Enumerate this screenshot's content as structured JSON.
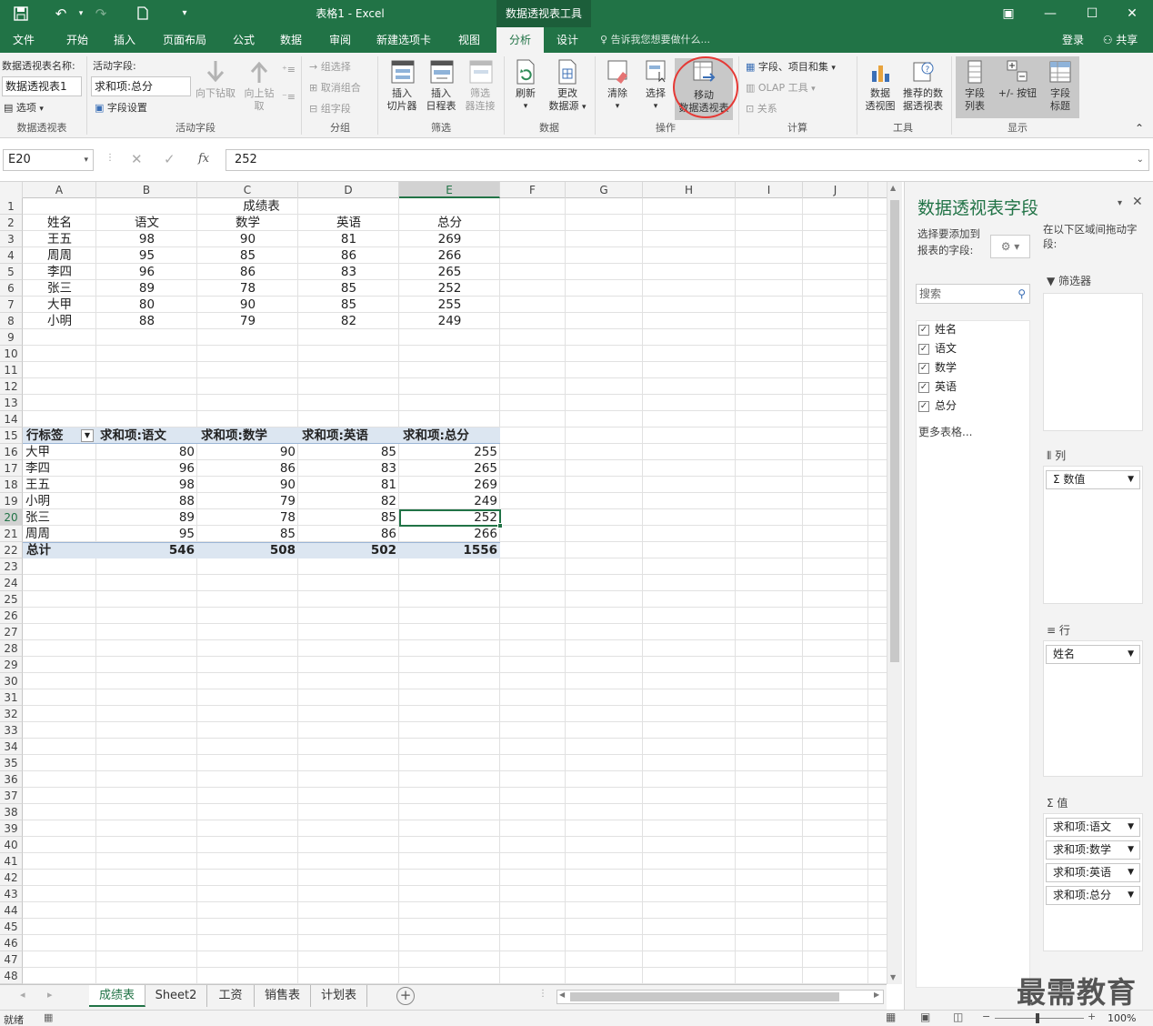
{
  "title_bar": {
    "title": "表格1 - Excel",
    "context_tool": "数据透视表工具"
  },
  "tabs": [
    "文件",
    "开始",
    "插入",
    "页面布局",
    "公式",
    "数据",
    "审阅",
    "新建选项卡",
    "视图",
    "分析",
    "设计"
  ],
  "active_tab": "分析",
  "tell_me": "告诉我您想要做什么...",
  "account": {
    "login": "登录",
    "share": "共享"
  },
  "ribbon": {
    "pt_name_label": "数据透视表名称:",
    "pt_name_value": "数据透视表1",
    "options": "选项",
    "group_pivottable": "数据透视表",
    "active_field_label": "活动字段:",
    "active_field_value": "求和项:总分",
    "field_settings": "字段设置",
    "drill_down": "向下钻取",
    "drill_up_1": "向上钻",
    "drill_up_2": "取",
    "group_active_field": "活动字段",
    "group_selection": "组选择",
    "ungroup": "取消组合",
    "group_field": "组字段",
    "group_group": "分组",
    "slicer_1": "插入",
    "slicer_2": "切片器",
    "timeline_1": "插入",
    "timeline_2": "日程表",
    "filter_conn_1": "筛选",
    "filter_conn_2": "器连接",
    "group_filter": "筛选",
    "refresh": "刷新",
    "change_src_1": "更改",
    "change_src_2": "数据源",
    "group_data": "数据",
    "clear": "清除",
    "select": "选择",
    "move_1": "移动",
    "move_2": "数据透视表",
    "group_actions": "操作",
    "fields_items": "字段、项目和集",
    "olap": "OLAP 工具",
    "relations": "关系",
    "group_calc": "计算",
    "pivotchart_1": "数据",
    "pivotchart_2": "透视图",
    "recommended_1": "推荐的数",
    "recommended_2": "据透视表",
    "group_tools": "工具",
    "field_list_1": "字段",
    "field_list_2": "列表",
    "plus_minus": "+/- 按钮",
    "field_headers_1": "字段",
    "field_headers_2": "标题",
    "group_show": "显示"
  },
  "formula_bar": {
    "name_box": "E20",
    "formula": "252",
    "fx": "fx"
  },
  "columns": [
    "A",
    "B",
    "C",
    "D",
    "E",
    "F",
    "G",
    "H",
    "I",
    "J"
  ],
  "sheet": {
    "title": "成绩表",
    "headers": [
      "姓名",
      "语文",
      "数学",
      "英语",
      "总分"
    ],
    "rows": [
      [
        "王五",
        "98",
        "90",
        "81",
        "269"
      ],
      [
        "周周",
        "95",
        "85",
        "86",
        "266"
      ],
      [
        "李四",
        "96",
        "86",
        "83",
        "265"
      ],
      [
        "张三",
        "89",
        "78",
        "85",
        "252"
      ],
      [
        "大甲",
        "80",
        "90",
        "85",
        "255"
      ],
      [
        "小明",
        "88",
        "79",
        "82",
        "249"
      ]
    ]
  },
  "pivot": {
    "headers": [
      "行标签",
      "求和项:语文",
      "求和项:数学",
      "求和项:英语",
      "求和项:总分"
    ],
    "rows": [
      [
        "大甲",
        "80",
        "90",
        "85",
        "255"
      ],
      [
        "李四",
        "96",
        "86",
        "83",
        "265"
      ],
      [
        "王五",
        "98",
        "90",
        "81",
        "269"
      ],
      [
        "小明",
        "88",
        "79",
        "82",
        "249"
      ],
      [
        "张三",
        "89",
        "78",
        "85",
        "252"
      ],
      [
        "周周",
        "95",
        "85",
        "86",
        "266"
      ]
    ],
    "total": [
      "总计",
      "546",
      "508",
      "502",
      "1556"
    ]
  },
  "sheet_tabs": [
    "成绩表",
    "Sheet2",
    "工资",
    "销售表",
    "计划表"
  ],
  "active_sheet": "成绩表",
  "status": {
    "ready": "就绪",
    "zoom": "100%"
  },
  "pane": {
    "title": "数据透视表字段",
    "choose_label": "选择要添加到报表的字段:",
    "drag_label": "在以下区域间拖动字段:",
    "search_placeholder": "搜索",
    "fields": [
      "姓名",
      "语文",
      "数学",
      "英语",
      "总分"
    ],
    "more_tables": "更多表格...",
    "filters": "筛选器",
    "columns": "列",
    "columns_item": "数值",
    "rows": "行",
    "rows_item": "姓名",
    "values": "值",
    "values_items": [
      "求和项:语文",
      "求和项:数学",
      "求和项:英语",
      "求和项:总分"
    ]
  },
  "watermark": "最需教育",
  "colors": {
    "excel_green": "#217346",
    "pivot_band": "#dce6f1",
    "annotation_red": "#e53935"
  }
}
